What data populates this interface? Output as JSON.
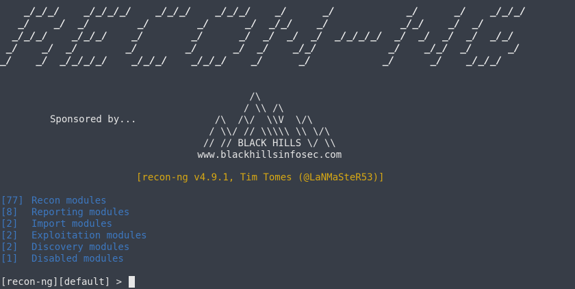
{
  "banner": {
    "logo_lines": [
      "    _/_/_/    _/_/_/_/    _/_/_/    _/_/_/    _/      _/            _/      _/    _/_/_/",
      "   _/    _/  _/        _/        _/      _/  _/_/    _/            _/_/    _/  _/",
      "  _/_/_/    _/_/_/    _/        _/      _/  _/  _/  _/  _/_/_/_/  _/  _/  _/  _/  _/_/",
      " _/    _/  _/        _/        _/      _/  _/    _/_/            _/    _/_/  _/      _/",
      "_/    _/  _/_/_/_/    _/_/_/    _/_/_/    _/      _/            _/      _/    _/_/_/"
    ]
  },
  "sponsor": {
    "label": "Sponsored by...",
    "art_lines": [
      "          /\\",
      "         / \\\\ /\\",
      "    /\\  /\\/  \\\\V  \\/\\",
      "   / \\\\/ // \\\\\\\\\\ \\\\ \\/\\",
      "  // // BLACK HILLS \\/ \\\\",
      " www.blackhillsinfosec.com"
    ]
  },
  "version_line": "[recon-ng v4.9.1, Tim Tomes (@LaNMaSteR53)]",
  "modules": [
    {
      "count": "[77]",
      "label": "Recon modules"
    },
    {
      "count": "[8]",
      "label": "Reporting modules"
    },
    {
      "count": "[2]",
      "label": "Import modules"
    },
    {
      "count": "[2]",
      "label": "Exploitation modules"
    },
    {
      "count": "[2]",
      "label": "Discovery modules"
    },
    {
      "count": "[1]",
      "label": "Disabled modules"
    }
  ],
  "prompt": {
    "text": "[recon-ng][default] > "
  },
  "colors": {
    "background": "#373d47",
    "text": "#e4e4e4",
    "version": "#d7a814",
    "modules": "#3d78c0"
  }
}
